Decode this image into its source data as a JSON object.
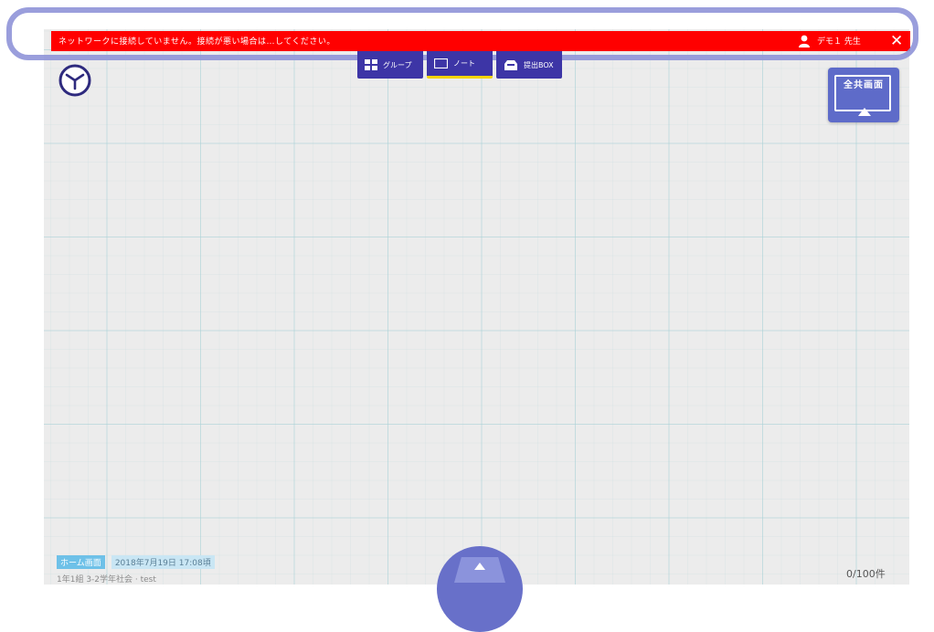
{
  "alert": {
    "message": "ネットワークに接続していません。接続が悪い場合は…してください。",
    "user_label": "デモ１ 先生",
    "close_glyph": "✕",
    "bg_color": "#ff0000"
  },
  "toolbar": {
    "items": [
      {
        "label": "グループ",
        "icon": "grid-icon"
      },
      {
        "label": "ノート",
        "icon": "note-icon",
        "active": true
      },
      {
        "label": "提出BOX",
        "icon": "inbox-icon"
      }
    ],
    "color": "#3d35a6",
    "active_indicator_color": "#f5d400"
  },
  "share_button": {
    "label": "全共画面",
    "icon": "screen-share-icon"
  },
  "timer": {
    "icon": "clock-icon"
  },
  "footer": {
    "tag": "ホーム画面",
    "date": "2018年7月19日 17:08頃",
    "class_info": "1年1組 3-2学年社会 · test",
    "counter": "0/100件",
    "upload_icon": "upload-icon"
  },
  "highlight": {
    "color": "#8f93d8"
  }
}
